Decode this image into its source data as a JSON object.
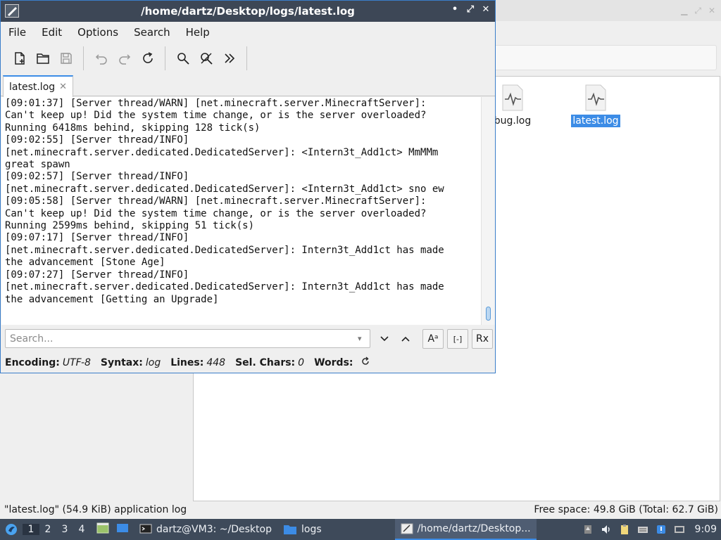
{
  "filemanager": {
    "files": [
      {
        "name": "bug.log",
        "selected": false
      },
      {
        "name": "latest.log",
        "selected": true
      }
    ],
    "status_left": "\"latest.log\" (54.9 KiB) application log",
    "status_right": "Free space: 49.8 GiB (Total: 62.7 GiB)"
  },
  "editor": {
    "title": "/home/dartz/Desktop/logs/latest.log",
    "menu": [
      "File",
      "Edit",
      "Options",
      "Search",
      "Help"
    ],
    "toolbar_icons": [
      "new-file-icon",
      "open-folder-icon",
      "save-icon",
      "undo-icon",
      "redo-icon",
      "reload-icon",
      "find-icon",
      "find-replace-icon",
      "more-icon"
    ],
    "tab": {
      "label": "latest.log",
      "close": "✕"
    },
    "lines": [
      "[09:01:37] [Server thread/WARN] [net.minecraft.server.MinecraftServer]:",
      "Can't keep up! Did the system time change, or is the server overloaded?",
      "Running 6418ms behind, skipping 128 tick(s)",
      "[09:02:55] [Server thread/INFO]",
      "[net.minecraft.server.dedicated.DedicatedServer]: <Intern3t_Add1ct> MmMMm",
      "great spawn",
      "[09:02:57] [Server thread/INFO]",
      "[net.minecraft.server.dedicated.DedicatedServer]: <Intern3t_Add1ct> sno ew",
      "[09:05:58] [Server thread/WARN] [net.minecraft.server.MinecraftServer]:",
      "Can't keep up! Did the system time change, or is the server overloaded?",
      "Running 2599ms behind, skipping 51 tick(s)",
      "[09:07:17] [Server thread/INFO]",
      "[net.minecraft.server.dedicated.DedicatedServer]: Intern3t_Add1ct has made",
      "the advancement [Stone Age]",
      "[09:07:27] [Server thread/INFO]",
      "[net.minecraft.server.dedicated.DedicatedServer]: Intern3t_Add1ct has made",
      "the advancement [Getting an Upgrade]"
    ],
    "search": {
      "placeholder": "Search...",
      "case_btn": "Aᵃ",
      "whole_btn": "[-]",
      "regex_btn": "Rx"
    },
    "status": {
      "encoding_label": "Encoding:",
      "encoding": "UTF-8",
      "syntax_label": "Syntax:",
      "syntax": "log",
      "lines_label": "Lines:",
      "lines": "448",
      "selchars_label": "Sel. Chars:",
      "selchars": "0",
      "words_label": "Words:"
    }
  },
  "taskbar": {
    "workspaces": [
      "1",
      "2",
      "3",
      "4"
    ],
    "tasks": [
      {
        "label": "dartz@VM3: ~/Desktop",
        "icon": "terminal-icon"
      },
      {
        "label": "logs",
        "icon": "folder-icon"
      },
      {
        "label": "/home/dartz/Desktop...",
        "icon": "text-editor-icon"
      }
    ],
    "clock": "9:09"
  }
}
